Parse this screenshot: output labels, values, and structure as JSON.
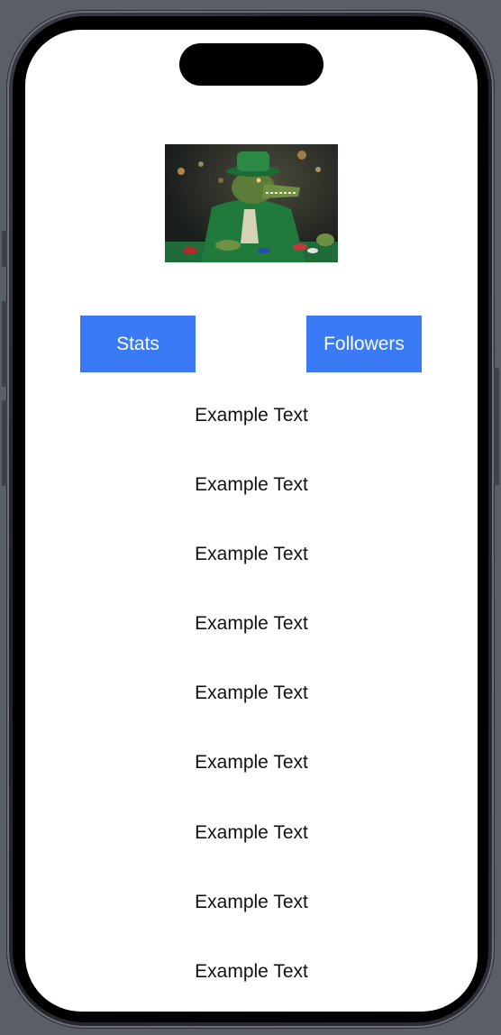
{
  "profile": {
    "image_icon": "crocodile-gambler-image"
  },
  "buttons": {
    "stats_label": "Stats",
    "followers_label": "Followers"
  },
  "list": {
    "items": [
      "Example Text",
      "Example Text",
      "Example Text",
      "Example Text",
      "Example Text",
      "Example Text",
      "Example Text",
      "Example Text",
      "Example Text"
    ]
  },
  "colors": {
    "accent": "#3a7af5",
    "background": "#ffffff",
    "text": "#111111"
  }
}
